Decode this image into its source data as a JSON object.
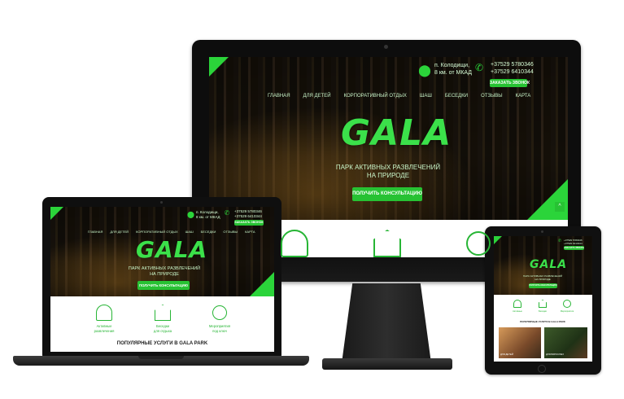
{
  "site": {
    "logo": "GALA",
    "tagline_1": "ПАРК АКТИВНЫХ РАЗВЛЕЧЕНИЙ",
    "tagline_2": "НА ПРИРОДЕ",
    "cta": "ПОЛУЧИТЬ КОНСУЛЬТАЦИЮ",
    "address_1": "п. Колодищи,",
    "address_2": "8 км. от МКАД",
    "phone_1": "+37529 5780346",
    "phone_2": "+37529 6410344",
    "call_button": "ЗАКАЗАТЬ ЗВОНОК",
    "nav": [
      "ГЛАВНАЯ",
      "ДЛЯ ДЕТЕЙ",
      "КОРПОРАТИВНЫЙ ОТДЫХ",
      "ШАШ",
      "БЕСЕДКИ",
      "ОТЗЫВЫ",
      "КАРТА"
    ],
    "services": [
      {
        "label_1": "Активные",
        "label_2": "развлечения",
        "icon": "tree-swing-icon"
      },
      {
        "label_1": "Беседки",
        "label_2": "для отдыха",
        "icon": "gazebo-icon"
      },
      {
        "label_1": "Мероприятия",
        "label_2": "под ключ",
        "icon": "key-icon"
      }
    ],
    "popular_title": "ПОПУЛЯРНЫЕ УСЛУГИ В GALA PARK",
    "popular_cards": [
      "ДЛЯ ДЕТЕЙ",
      "ДЛЯ ВЗРОСЛЫХ"
    ]
  },
  "colors": {
    "accent": "#27c233",
    "logo": "#3be04a",
    "device": "#111111"
  }
}
